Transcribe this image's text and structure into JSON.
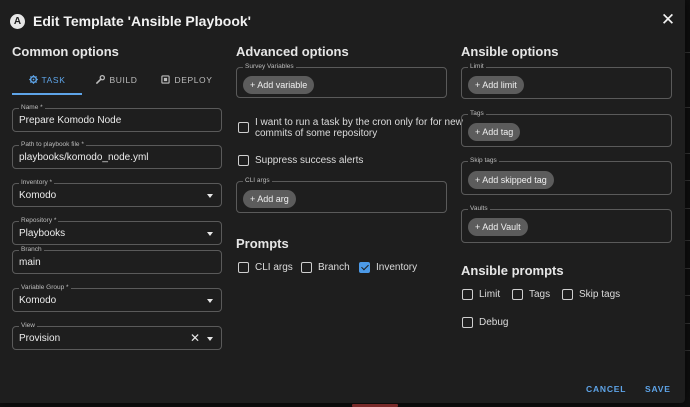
{
  "dialog": {
    "title": "Edit Template 'Ansible Playbook'",
    "logo_letter": "A"
  },
  "common": {
    "heading": "Common options",
    "tabs": [
      {
        "label": "TASK",
        "icon": "gear-icon",
        "active": true
      },
      {
        "label": "BUILD",
        "icon": "wrench-icon",
        "active": false
      },
      {
        "label": "DEPLOY",
        "icon": "deploy-icon",
        "active": false
      }
    ],
    "fields": {
      "name": {
        "label": "Name *",
        "value": "Prepare Komodo Node"
      },
      "playbook": {
        "label": "Path to playbook file *",
        "value": "playbooks/komodo_node.yml"
      },
      "inventory": {
        "label": "Inventory *",
        "value": "Komodo"
      },
      "repository": {
        "label": "Repository *",
        "value": "Playbooks"
      },
      "branch": {
        "label": "Branch",
        "value": "main"
      },
      "variable_group": {
        "label": "Variable Group *",
        "value": "Komodo"
      },
      "view": {
        "label": "View",
        "value": "Provision"
      }
    }
  },
  "advanced": {
    "heading": "Advanced options",
    "survey": {
      "label": "Survey Variables",
      "button": "+ Add variable"
    },
    "cron_checkbox": {
      "line1": "I want to run a task by the cron only for for new",
      "line2": "commits of some repository",
      "checked": false
    },
    "suppress_checkbox": {
      "label": "Suppress success alerts",
      "checked": false
    },
    "cli_args": {
      "label": "CLI args",
      "button": "+ Add arg"
    }
  },
  "prompts": {
    "heading": "Prompts",
    "items": [
      {
        "label": "CLI args",
        "checked": false
      },
      {
        "label": "Branch",
        "checked": false
      },
      {
        "label": "Inventory",
        "checked": true
      }
    ]
  },
  "ansible": {
    "heading": "Ansible options",
    "limit": {
      "label": "Limit",
      "button": "+ Add limit"
    },
    "tags": {
      "label": "Tags",
      "button": "+ Add tag"
    },
    "skip_tags": {
      "label": "Skip tags",
      "button": "+ Add skipped tag"
    },
    "vaults": {
      "label": "Vaults",
      "button": "+ Add Vault"
    }
  },
  "ansible_prompts": {
    "heading": "Ansible prompts",
    "items": [
      {
        "label": "Limit",
        "checked": false
      },
      {
        "label": "Tags",
        "checked": false
      },
      {
        "label": "Skip tags",
        "checked": false
      },
      {
        "label": "Debug",
        "checked": false
      }
    ]
  },
  "actions": {
    "cancel": "CANCEL",
    "save": "SAVE"
  },
  "colors": {
    "accent": "#5ea4e8",
    "background": "#1e1e1e",
    "chip": "#5c5c5c",
    "checked": "#4c9ae8"
  }
}
